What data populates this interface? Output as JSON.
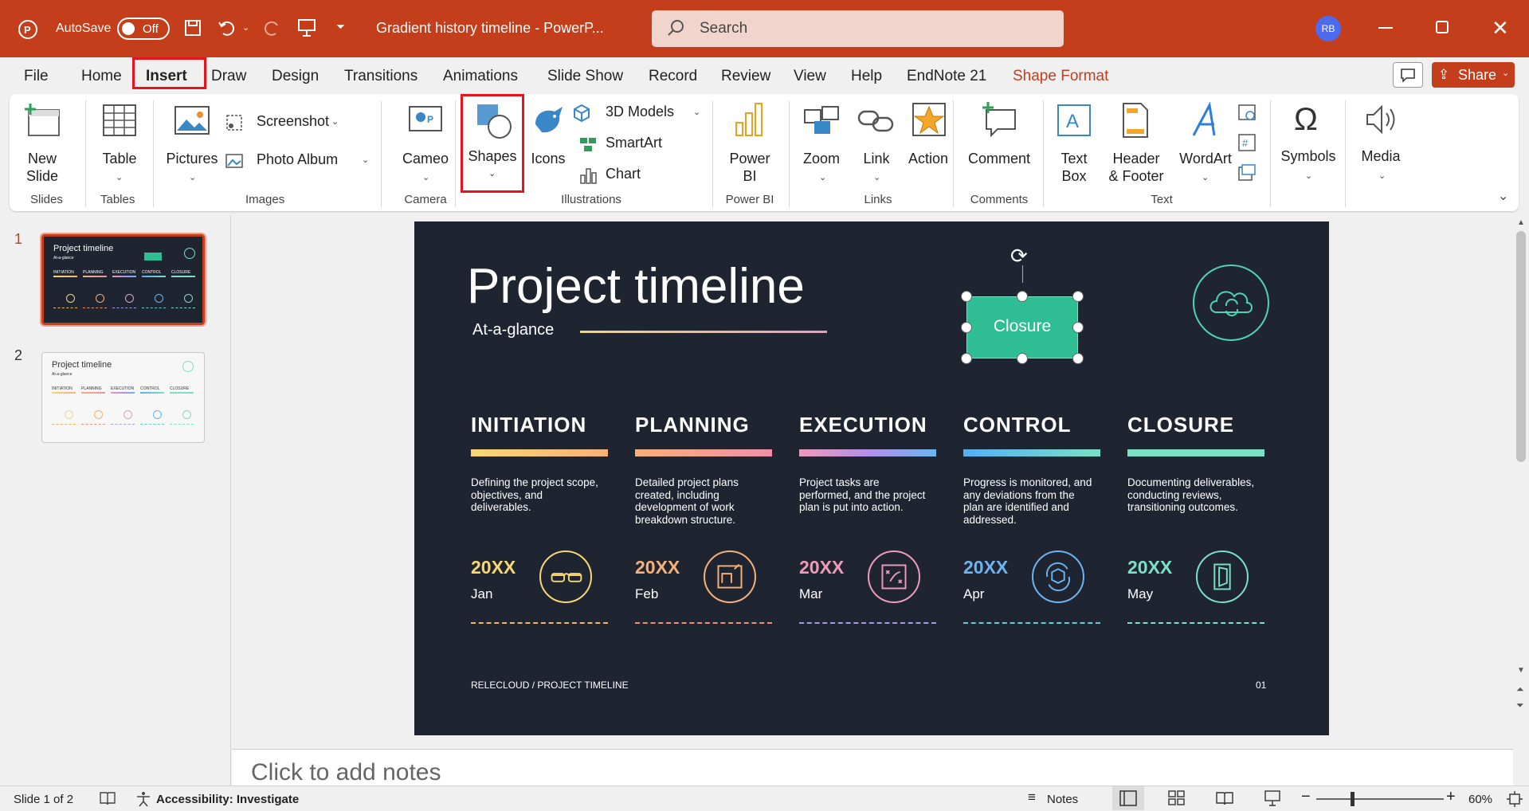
{
  "titlebar": {
    "autosave_label": "AutoSave",
    "autosave_state": "Off",
    "doc_title": "Gradient history timeline  -  PowerP...",
    "search_placeholder": "Search",
    "user_initials": "RB"
  },
  "menu": {
    "tabs": [
      "File",
      "Home",
      "Insert",
      "Draw",
      "Design",
      "Transitions",
      "Animations",
      "Slide Show",
      "Record",
      "Review",
      "View",
      "Help",
      "EndNote 21",
      "Shape Format"
    ],
    "active": "Insert",
    "share_label": "Share"
  },
  "ribbon": {
    "new_slide": [
      "New",
      "Slide"
    ],
    "table": "Table",
    "pictures": "Pictures",
    "screenshot": "Screenshot",
    "photo_album": "Photo Album",
    "cameo": "Cameo",
    "shapes": "Shapes",
    "icons": "Icons",
    "models3d": "3D Models",
    "smartart": "SmartArt",
    "chart": "Chart",
    "powerbi": [
      "Power",
      "BI"
    ],
    "zoom": "Zoom",
    "link": "Link",
    "action": "Action",
    "comment": "Comment",
    "textbox": [
      "Text",
      "Box"
    ],
    "header_footer": [
      "Header",
      "& Footer"
    ],
    "wordart": "WordArt",
    "symbols": "Symbols",
    "media": "Media",
    "groups": {
      "slides": "Slides",
      "tables": "Tables",
      "images": "Images",
      "camera": "Camera",
      "illustrations": "Illustrations",
      "powerbi": "Power BI",
      "links": "Links",
      "comments": "Comments",
      "text": "Text"
    }
  },
  "thumbnails": [
    {
      "number": "1",
      "title": "Project timeline",
      "sub": "At-a-glance",
      "phases": [
        "INITIATION",
        "PLANNING",
        "EXECUTION",
        "CONTROL",
        "CLOSURE"
      ]
    },
    {
      "number": "2",
      "title": "Project timeline",
      "sub": "At-a-glance",
      "phases": [
        "INITIATION",
        "PLANNING",
        "EXECUTION",
        "CONTROL",
        "CLOSURE"
      ]
    }
  ],
  "slide": {
    "title": "Project timeline",
    "subtitle": "At-a-glance",
    "selected_shape_text": "Closure",
    "phases": [
      {
        "name": "INITIATION",
        "desc": "Defining the project scope, objectives, and deliverables.",
        "year": "20XX",
        "month": "Jan",
        "color": "#f7d774",
        "icon": "glasses-icon"
      },
      {
        "name": "PLANNING",
        "desc": "Detailed project plans created, including development of work breakdown structure.",
        "year": "20XX",
        "month": "Feb",
        "color": "#f6b07a",
        "icon": "blueprint-icon"
      },
      {
        "name": "EXECUTION",
        "desc": "Project tasks are performed, and the project plan is put into action.",
        "year": "20XX",
        "month": "Mar",
        "color": "#ef9ab8",
        "icon": "strategy-board-icon"
      },
      {
        "name": "CONTROL",
        "desc": "Progress is monitored, and any deviations from the plan are identified and addressed.",
        "year": "20XX",
        "month": "Apr",
        "color": "#6cb4f0",
        "icon": "cube-cycle-icon"
      },
      {
        "name": "CLOSURE",
        "desc": "Documenting deliverables, conducting reviews, transitioning outcomes.",
        "year": "20XX",
        "month": "May",
        "color": "#7be0c5",
        "icon": "door-exit-icon"
      }
    ],
    "footer_left": "RELECLOUD / PROJECT TIMELINE",
    "footer_right": "01"
  },
  "notes_placeholder": "Click to add notes",
  "status": {
    "slide_count": "Slide 1 of 2",
    "accessibility": "Accessibility: Investigate",
    "notes": "Notes",
    "zoom": "60%"
  }
}
